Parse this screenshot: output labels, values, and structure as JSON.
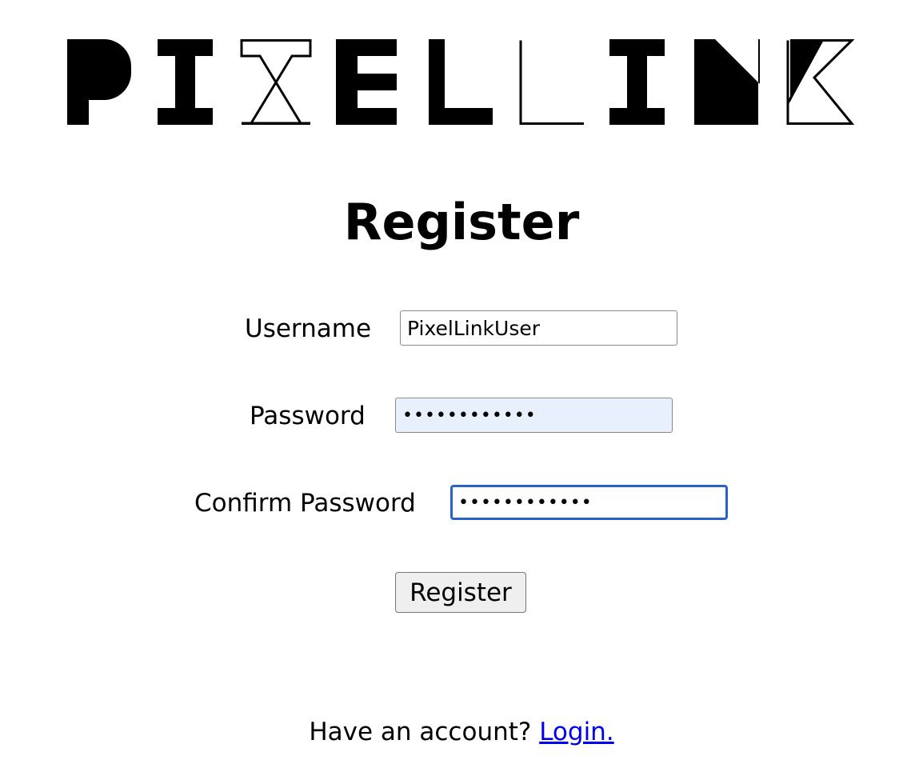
{
  "logo": {
    "text": "PIXELLINK"
  },
  "page_title": "Register",
  "form": {
    "username": {
      "label": "Username",
      "value": "PixelLinkUser"
    },
    "password": {
      "label": "Password",
      "value": "••••••••••••"
    },
    "confirm_password": {
      "label": "Confirm Password",
      "value": "••••••••••••"
    },
    "submit_label": "Register"
  },
  "footer": {
    "prompt": "Have an account?",
    "link_label": "Login."
  },
  "colors": {
    "link": "#0000ee",
    "focus_border": "#2a63c8",
    "autofill_bg": "#e8f0fe",
    "button_bg": "#efefef"
  }
}
